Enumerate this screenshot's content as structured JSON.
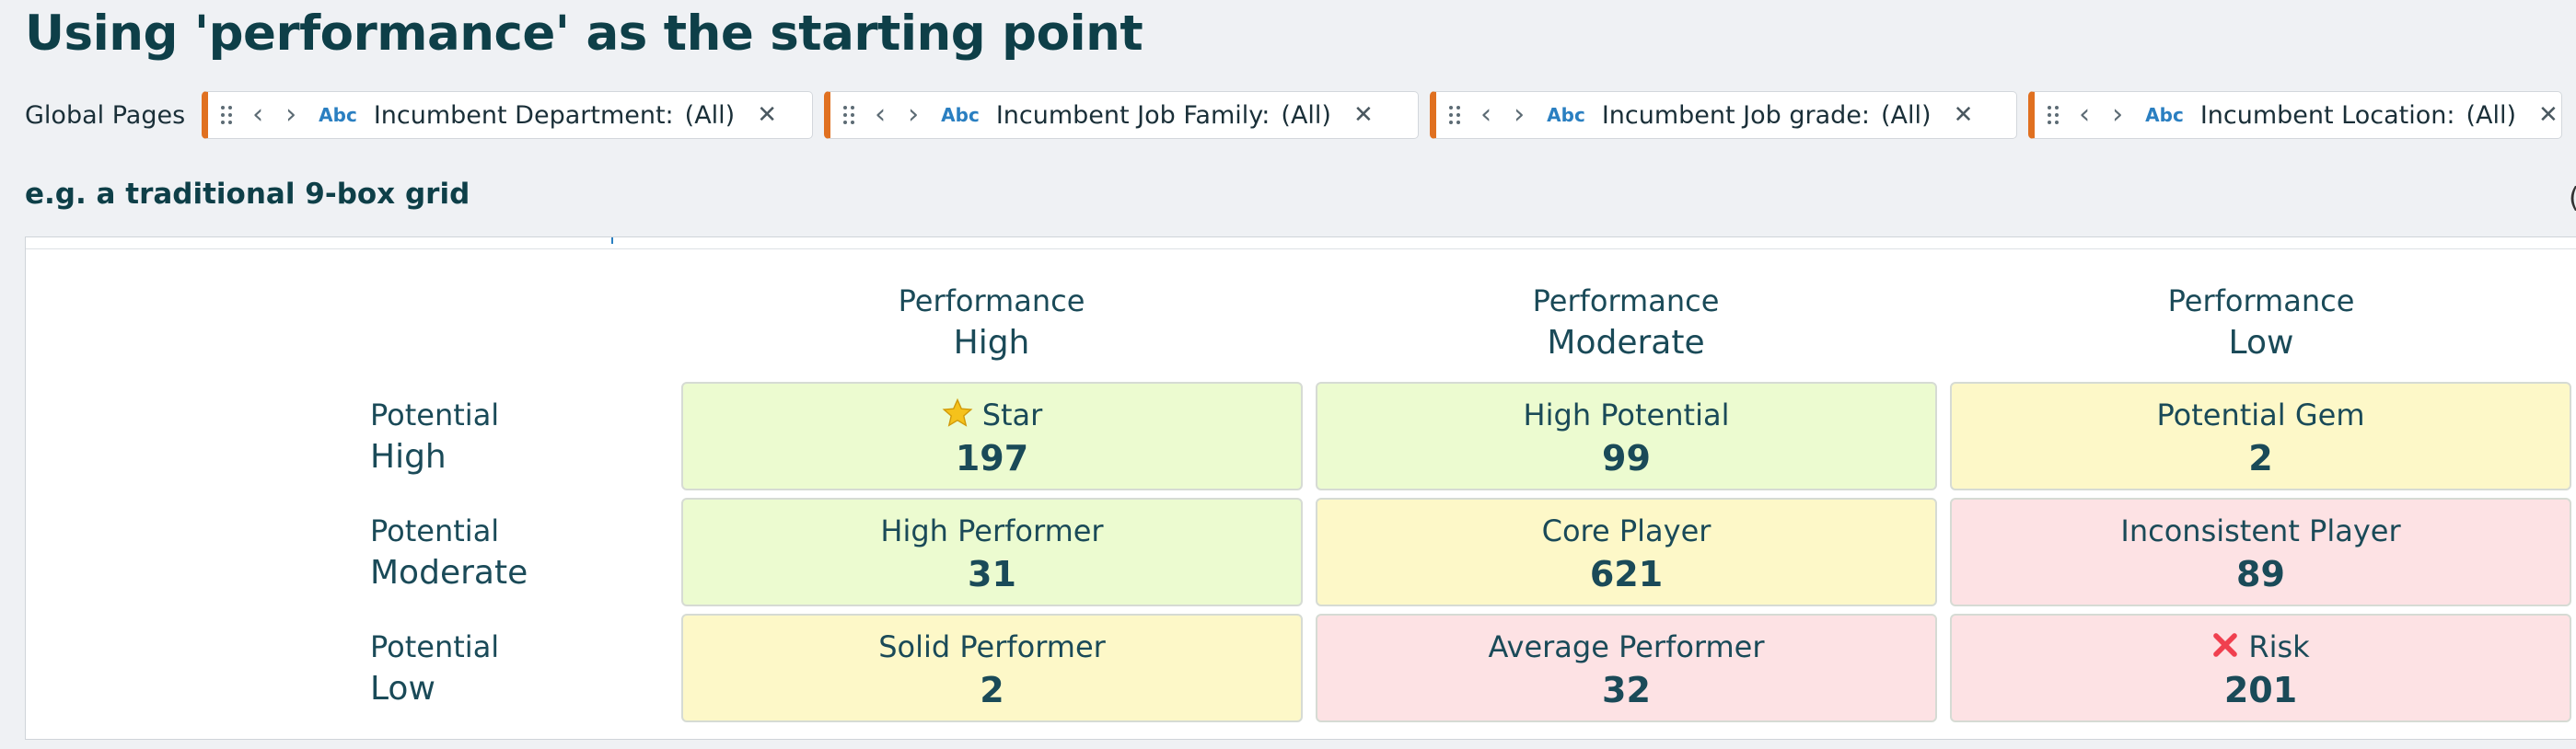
{
  "page": {
    "title": "Using 'performance' as the starting point"
  },
  "filters": {
    "label": "Global Pages",
    "chips": [
      {
        "type_label": "Abc",
        "field": "Incumbent Department:",
        "value": "(All)"
      },
      {
        "type_label": "Abc",
        "field": "Incumbent Job Family:",
        "value": "(All)"
      },
      {
        "type_label": "Abc",
        "field": "Incumbent Job grade:",
        "value": "(All)"
      },
      {
        "type_label": "Abc",
        "field": "Incumbent Location:",
        "value": "(All)"
      }
    ]
  },
  "section": {
    "title": "e.g. a traditional 9-box grid",
    "edge_text": "("
  },
  "grid": {
    "columns": [
      {
        "top": "Performance",
        "bottom": "High"
      },
      {
        "top": "Performance",
        "bottom": "Moderate"
      },
      {
        "top": "Performance",
        "bottom": "Low"
      }
    ],
    "rows": [
      {
        "top": "Potential",
        "bottom": "High"
      },
      {
        "top": "Potential",
        "bottom": "Moderate"
      },
      {
        "top": "Potential",
        "bottom": "Low"
      }
    ],
    "colors": {
      "green": "#ecfbd0",
      "yellow": "#fdf8c8",
      "red": "#fde2e4"
    },
    "cells": [
      [
        {
          "label": "Star",
          "count": "197",
          "color": "green",
          "icon": "star-icon"
        },
        {
          "label": "High Potential",
          "count": "99",
          "color": "green"
        },
        {
          "label": "Potential Gem",
          "count": "2",
          "color": "yellow"
        }
      ],
      [
        {
          "label": "High Performer",
          "count": "31",
          "color": "green"
        },
        {
          "label": "Core Player",
          "count": "621",
          "color": "yellow"
        },
        {
          "label": "Inconsistent Player",
          "count": "89",
          "color": "red"
        }
      ],
      [
        {
          "label": "Solid Performer",
          "count": "2",
          "color": "yellow"
        },
        {
          "label": "Average Performer",
          "count": "32",
          "color": "red"
        },
        {
          "label": "Risk",
          "count": "201",
          "color": "red",
          "icon": "cross-icon"
        }
      ]
    ]
  }
}
